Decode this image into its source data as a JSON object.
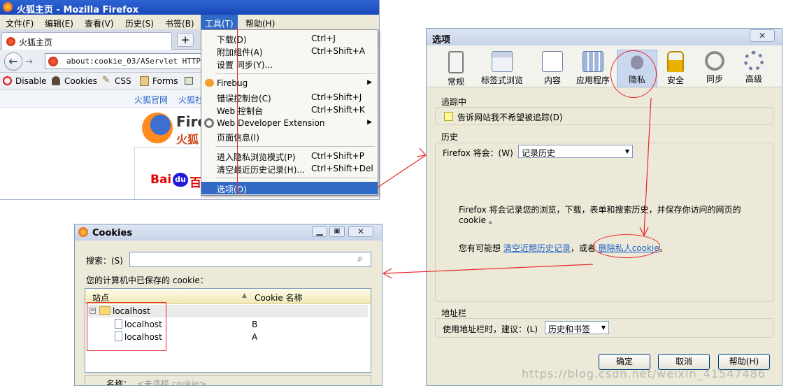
{
  "firefox": {
    "title": "火狐主页 - Mozilla Firefox",
    "menus": [
      "文件(F)",
      "编辑(E)",
      "查看(V)",
      "历史(S)",
      "书签(B)",
      "工具(T)",
      "帮助(H)"
    ],
    "tab_title": "火狐主页",
    "new_tab": "+",
    "url": "about:cookie_03/AServlet HTTP",
    "devtoolbar": {
      "disable": "Disable",
      "cookies": "Cookies",
      "css": "CSS",
      "forms": "Forms"
    },
    "page": {
      "link1": "火狐官网",
      "link2": "火狐社",
      "brand1": "Fire",
      "brand2": "火狐",
      "baidu_bai": "Bai",
      "baidu_du": "du",
      "baidu_bai2": "百"
    }
  },
  "tools_menu": {
    "items": [
      {
        "label": "下载(D)",
        "shortcut": "Ctrl+J"
      },
      {
        "label": "附加组件(A)",
        "shortcut": "Ctrl+Shift+A"
      },
      {
        "label": "设置 同步(Y)...",
        "shortcut": ""
      },
      {
        "label": "Firebug",
        "shortcut": ""
      },
      {
        "label": "错误控制台(C)",
        "shortcut": "Ctrl+Shift+J"
      },
      {
        "label": "Web 控制台",
        "shortcut": "Ctrl+Shift+K"
      },
      {
        "label": "Web Developer Extension",
        "shortcut": ""
      },
      {
        "label": "页面信息(I)",
        "shortcut": ""
      },
      {
        "label": "进入隐私浏览模式(P)",
        "shortcut": "Ctrl+Shift+P"
      },
      {
        "label": "清空最近历史记录(H)...",
        "shortcut": "Ctrl+Shift+Del"
      },
      {
        "label": "选项(O)",
        "shortcut": ""
      }
    ]
  },
  "options": {
    "title": "选项",
    "panes": [
      "常规",
      "标签式浏览",
      "内容",
      "应用程序",
      "隐私",
      "安全",
      "同步",
      "高级"
    ],
    "selected_pane": "隐私",
    "tracking": {
      "title": "追踪中",
      "checkbox_label": "告诉网站我不希望被追踪(D)"
    },
    "history": {
      "title": "历史",
      "firefox_will_label": "Firefox 将会：(W)",
      "firefox_will_value": "记录历史",
      "desc": "Firefox 将会记录您的浏览，下载，表单和搜索历史，并保存你访问的网页的 cookie 。",
      "maybe_prefix": "您有可能想",
      "clear_link": "清空近期历史记录",
      "or_text": "，或者",
      "remove_link": "删除私人cookie",
      "period": "。"
    },
    "locationbar": {
      "title": "地址栏",
      "suggest_label": "使用地址栏时，建议：(L)",
      "suggest_value": "历史和书签"
    },
    "buttons": {
      "ok": "确定",
      "cancel": "取消",
      "help": "帮助(H)"
    },
    "watermark": "https://blog.csdn.net/weixin_41547486"
  },
  "cookies": {
    "title": "Cookies",
    "search_label": "搜索：(S)",
    "search_value": "",
    "stored_label": "您的计算机中已保存的 cookie：",
    "col_site": "站点",
    "col_name": "Cookie 名称",
    "rows": [
      {
        "site": "localhost",
        "name": ""
      },
      {
        "site": "localhost",
        "name": "B"
      },
      {
        "site": "localhost",
        "name": "A"
      }
    ],
    "name_label": "名称：",
    "name_placeholder": "<未选择 cookie>"
  },
  "colors": {
    "annotation": "#e8262a",
    "menu_highlight": "#316ac5",
    "link": "#1e62c8",
    "titlebar": "#1847b8"
  }
}
